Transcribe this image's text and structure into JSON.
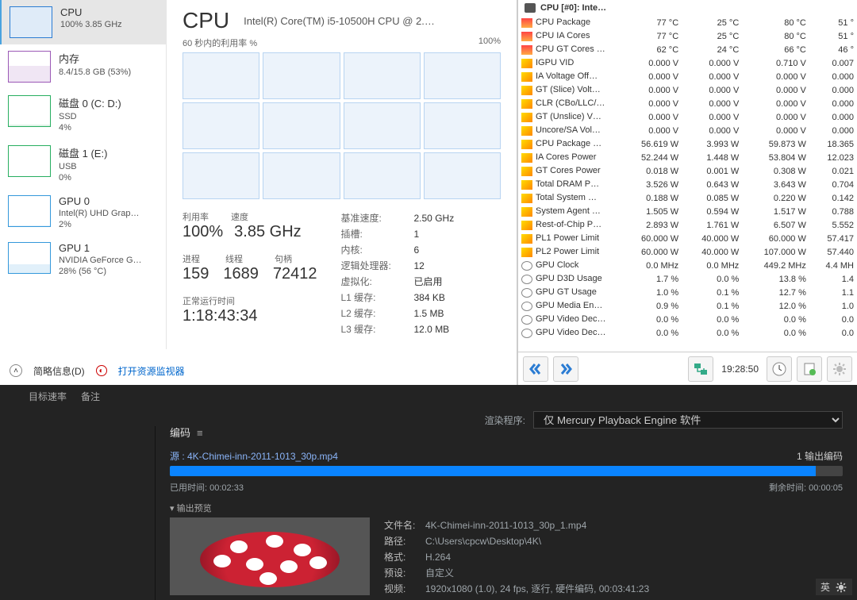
{
  "taskmgr": {
    "sidebar": [
      {
        "title": "CPU",
        "sub": "100% 3.85 GHz",
        "cls": "cpu"
      },
      {
        "title": "内存",
        "sub": "8.4/15.8 GB (53%)",
        "cls": "mem"
      },
      {
        "title": "磁盘 0 (C: D:)",
        "sub": "SSD",
        "sub2": "4%",
        "cls": "disk d0"
      },
      {
        "title": "磁盘 1 (E:)",
        "sub": "USB",
        "sub2": "0%",
        "cls": "disk"
      },
      {
        "title": "GPU 0",
        "sub": "Intel(R) UHD Grap…",
        "sub2": "2%",
        "cls": "gpu gpu0"
      },
      {
        "title": "GPU 1",
        "sub": "NVIDIA GeForce G…",
        "sub2": "28% (56 °C)",
        "cls": "gpu gpu1"
      }
    ],
    "heading": "CPU",
    "cpu_name": "Intel(R) Core(TM) i5-10500H CPU @ 2.…",
    "graph_label": "60 秒内的利用率 %",
    "graph_right": "100%",
    "stats": {
      "util_lbl": "利用率",
      "util": "100%",
      "speed_lbl": "速度",
      "speed": "3.85 GHz",
      "proc_lbl": "进程",
      "proc": "159",
      "thr_lbl": "线程",
      "thr": "1689",
      "hnd_lbl": "句柄",
      "hnd": "72412",
      "up_lbl": "正常运行时间",
      "up": "1:18:43:34"
    },
    "info": {
      "base_lbl": "基准速度:",
      "base": "2.50 GHz",
      "sock_lbl": "插槽:",
      "sock": "1",
      "core_lbl": "内核:",
      "core": "6",
      "lp_lbl": "逻辑处理器:",
      "lp": "12",
      "virt_lbl": "虚拟化:",
      "virt": "已启用",
      "l1_lbl": "L1 缓存:",
      "l1": "384 KB",
      "l2_lbl": "L2 缓存:",
      "l2": "1.5 MB",
      "l3_lbl": "L3 缓存:",
      "l3": "12.0 MB"
    },
    "foot": {
      "brief": "简略信息(D)",
      "resmon": "打开资源监视器"
    }
  },
  "hwi": {
    "title": "CPU [#0]: Inte…",
    "rows": [
      {
        "ic": "temp",
        "n": "CPU Package",
        "v": [
          "77 °C",
          "25 °C",
          "80 °C",
          "51 °"
        ]
      },
      {
        "ic": "temp",
        "n": "CPU IA Cores",
        "v": [
          "77 °C",
          "25 °C",
          "80 °C",
          "51 °"
        ]
      },
      {
        "ic": "temp",
        "n": "CPU GT Cores …",
        "v": [
          "62 °C",
          "24 °C",
          "66 °C",
          "46 °"
        ]
      },
      {
        "ic": "volt",
        "n": "IGPU VID",
        "v": [
          "0.000 V",
          "0.000 V",
          "0.710 V",
          "0.007"
        ]
      },
      {
        "ic": "volt",
        "n": "IA Voltage Off…",
        "v": [
          "0.000 V",
          "0.000 V",
          "0.000 V",
          "0.000"
        ]
      },
      {
        "ic": "volt",
        "n": "GT (Slice) Volt…",
        "v": [
          "0.000 V",
          "0.000 V",
          "0.000 V",
          "0.000"
        ]
      },
      {
        "ic": "volt",
        "n": "CLR (CBo/LLC/…",
        "v": [
          "0.000 V",
          "0.000 V",
          "0.000 V",
          "0.000"
        ]
      },
      {
        "ic": "volt",
        "n": "GT (Unslice) V…",
        "v": [
          "0.000 V",
          "0.000 V",
          "0.000 V",
          "0.000"
        ]
      },
      {
        "ic": "volt",
        "n": "Uncore/SA Vol…",
        "v": [
          "0.000 V",
          "0.000 V",
          "0.000 V",
          "0.000"
        ]
      },
      {
        "ic": "volt",
        "n": "CPU Package …",
        "v": [
          "56.619 W",
          "3.993 W",
          "59.873 W",
          "18.365"
        ]
      },
      {
        "ic": "volt",
        "n": "IA Cores Power",
        "v": [
          "52.244 W",
          "1.448 W",
          "53.804 W",
          "12.023"
        ]
      },
      {
        "ic": "volt",
        "n": "GT Cores Power",
        "v": [
          "0.018 W",
          "0.001 W",
          "0.308 W",
          "0.021"
        ]
      },
      {
        "ic": "volt",
        "n": "Total DRAM P…",
        "v": [
          "3.526 W",
          "0.643 W",
          "3.643 W",
          "0.704"
        ]
      },
      {
        "ic": "volt",
        "n": "Total System …",
        "v": [
          "0.188 W",
          "0.085 W",
          "0.220 W",
          "0.142"
        ]
      },
      {
        "ic": "volt",
        "n": "System Agent …",
        "v": [
          "1.505 W",
          "0.594 W",
          "1.517 W",
          "0.788"
        ]
      },
      {
        "ic": "volt",
        "n": "Rest-of-Chip P…",
        "v": [
          "2.893 W",
          "1.761 W",
          "6.507 W",
          "5.552"
        ]
      },
      {
        "ic": "volt",
        "n": "PL1 Power Limit",
        "v": [
          "60.000 W",
          "40.000 W",
          "60.000 W",
          "57.417"
        ]
      },
      {
        "ic": "volt",
        "n": "PL2 Power Limit",
        "v": [
          "60.000 W",
          "40.000 W",
          "107.000 W",
          "57.440"
        ]
      },
      {
        "ic": "clk",
        "n": "GPU Clock",
        "v": [
          "0.0 MHz",
          "0.0 MHz",
          "449.2 MHz",
          "4.4 MH"
        ]
      },
      {
        "ic": "clk",
        "n": "GPU D3D Usage",
        "v": [
          "1.7 %",
          "0.0 %",
          "13.8 %",
          "1.4"
        ]
      },
      {
        "ic": "clk",
        "n": "GPU GT Usage",
        "v": [
          "1.0 %",
          "0.1 %",
          "12.7 %",
          "1.1"
        ]
      },
      {
        "ic": "clk",
        "n": "GPU Media En…",
        "v": [
          "0.9 %",
          "0.1 %",
          "12.0 %",
          "1.0"
        ]
      },
      {
        "ic": "clk",
        "n": "GPU Video Dec…",
        "v": [
          "0.0 %",
          "0.0 %",
          "0.0 %",
          "0.0"
        ]
      },
      {
        "ic": "clk",
        "n": "GPU Video Dec…",
        "v": [
          "0.0 %",
          "0.0 %",
          "0.0 %",
          "0.0"
        ]
      }
    ],
    "time": "19:28:50"
  },
  "ame": {
    "tabs": [
      "目标速率",
      "备注"
    ],
    "render_lbl": "渲染程序:",
    "render_opt": "仅 Mercury Playback Engine 软件",
    "panel": "编码",
    "source_lbl": "源 : 4K-Chimei-inn-2011-1013_30p.mp4",
    "count": "1 输出编码",
    "elapsed_lbl": "已用时间:",
    "elapsed": "00:02:33",
    "remain_lbl": "剩余时间:",
    "remain": "00:00:05",
    "preview_lbl": "输出预览",
    "meta": {
      "file_lbl": "文件名:",
      "file": "4K-Chimei-inn-2011-1013_30p_1.mp4",
      "path_lbl": "路径:",
      "path": "C:\\Users\\cpcw\\Desktop\\4K\\",
      "fmt_lbl": "格式:",
      "fmt": "H.264",
      "preset_lbl": "预设:",
      "preset": "自定义",
      "video_lbl": "视频:",
      "video": "1920x1080 (1.0), 24 fps, 逐行, 硬件编码, 00:03:41:23"
    }
  },
  "ime": {
    "mode": "英"
  }
}
